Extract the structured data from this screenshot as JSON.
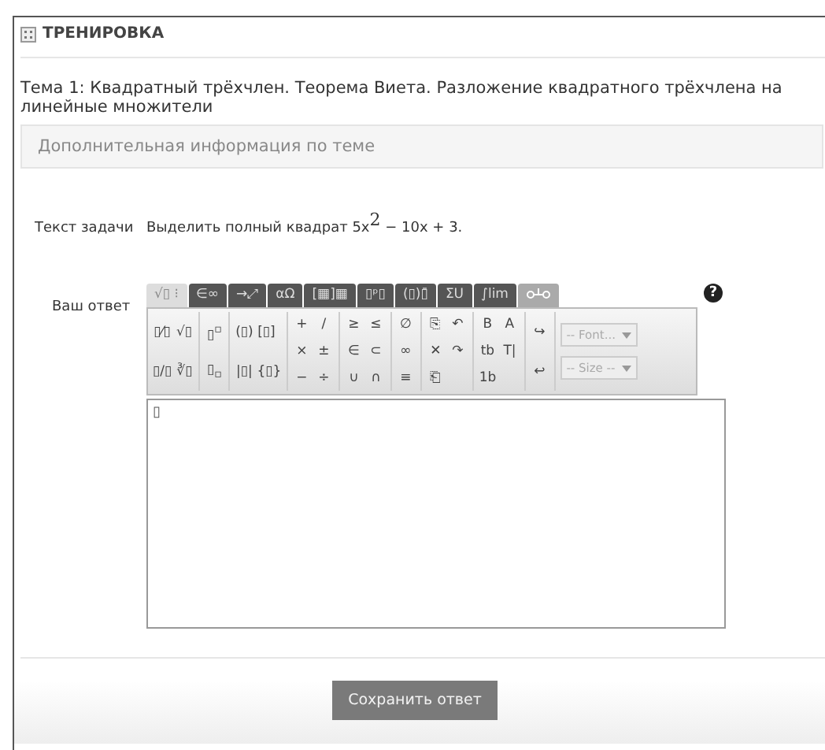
{
  "panel": {
    "title": "ТРЕНИРОВКА"
  },
  "topic": "Тема 1: Квадратный трёхчлен. Теорема Виета. Разложение квадратного трёхчлена на линейные множители",
  "extra_info": "Дополнительная информация по теме",
  "task": {
    "label": "Текст задачи",
    "text": "Выделить полный квадрат 5x$^{2}$ − 10x + 3."
  },
  "answer": {
    "label": "Ваш ответ",
    "value": "▯",
    "help": "?",
    "tabs": [
      {
        "kind": "text",
        "label": "√▯ ⁝",
        "selected": true
      },
      {
        "kind": "text",
        "label": "∈∞",
        "selected": false
      },
      {
        "kind": "text",
        "label": "→⤢",
        "selected": false
      },
      {
        "kind": "text",
        "label": "αΩ",
        "selected": false
      },
      {
        "kind": "text",
        "label": "[▦]▦",
        "selected": false
      },
      {
        "kind": "text",
        "label": "▯ᵖ▯",
        "selected": false
      },
      {
        "kind": "text",
        "label": "(▯)▯̄",
        "selected": false
      },
      {
        "kind": "text",
        "label": "ΣU",
        "selected": false
      },
      {
        "kind": "text",
        "label": "∫lim",
        "selected": false
      },
      {
        "kind": "icon",
        "selected": false
      }
    ],
    "palette": [
      {
        "rows": [
          [
            "▯⁄▯",
            "√▯"
          ],
          [
            "▯/▯",
            "∛▯"
          ]
        ]
      },
      {
        "rows": [
          [
            "▯$^{▫}$"
          ],
          [
            "▯$_{▫}$"
          ]
        ]
      },
      {
        "rows": [
          [
            "(▯)",
            "[▯]"
          ],
          [
            "|▯|",
            "{▯}"
          ]
        ]
      },
      {
        "rows": [
          [
            "+",
            "/"
          ],
          [
            "×",
            "±"
          ],
          [
            "−",
            "÷"
          ]
        ]
      },
      {
        "rows": [
          [
            "≥",
            "≤"
          ],
          [
            "∈",
            "⊂"
          ],
          [
            "∪",
            "∩"
          ]
        ]
      },
      {
        "rows": [
          [
            "∅"
          ],
          [
            "∞"
          ],
          [
            "≡"
          ]
        ]
      },
      {
        "rows": [
          [
            "⎘",
            "↶"
          ],
          [
            "✕",
            "↷"
          ],
          [
            "⎗"
          ]
        ]
      },
      {
        "rows": [
          [
            "B",
            "A"
          ],
          [
            "tb",
            "T|"
          ],
          [
            "1b"
          ]
        ]
      },
      {
        "rows": [
          [
            "↪"
          ],
          [
            "↩"
          ]
        ]
      }
    ],
    "selects": [
      "-- Font...",
      "-- Size --"
    ]
  },
  "save_button": "Сохранить ответ"
}
